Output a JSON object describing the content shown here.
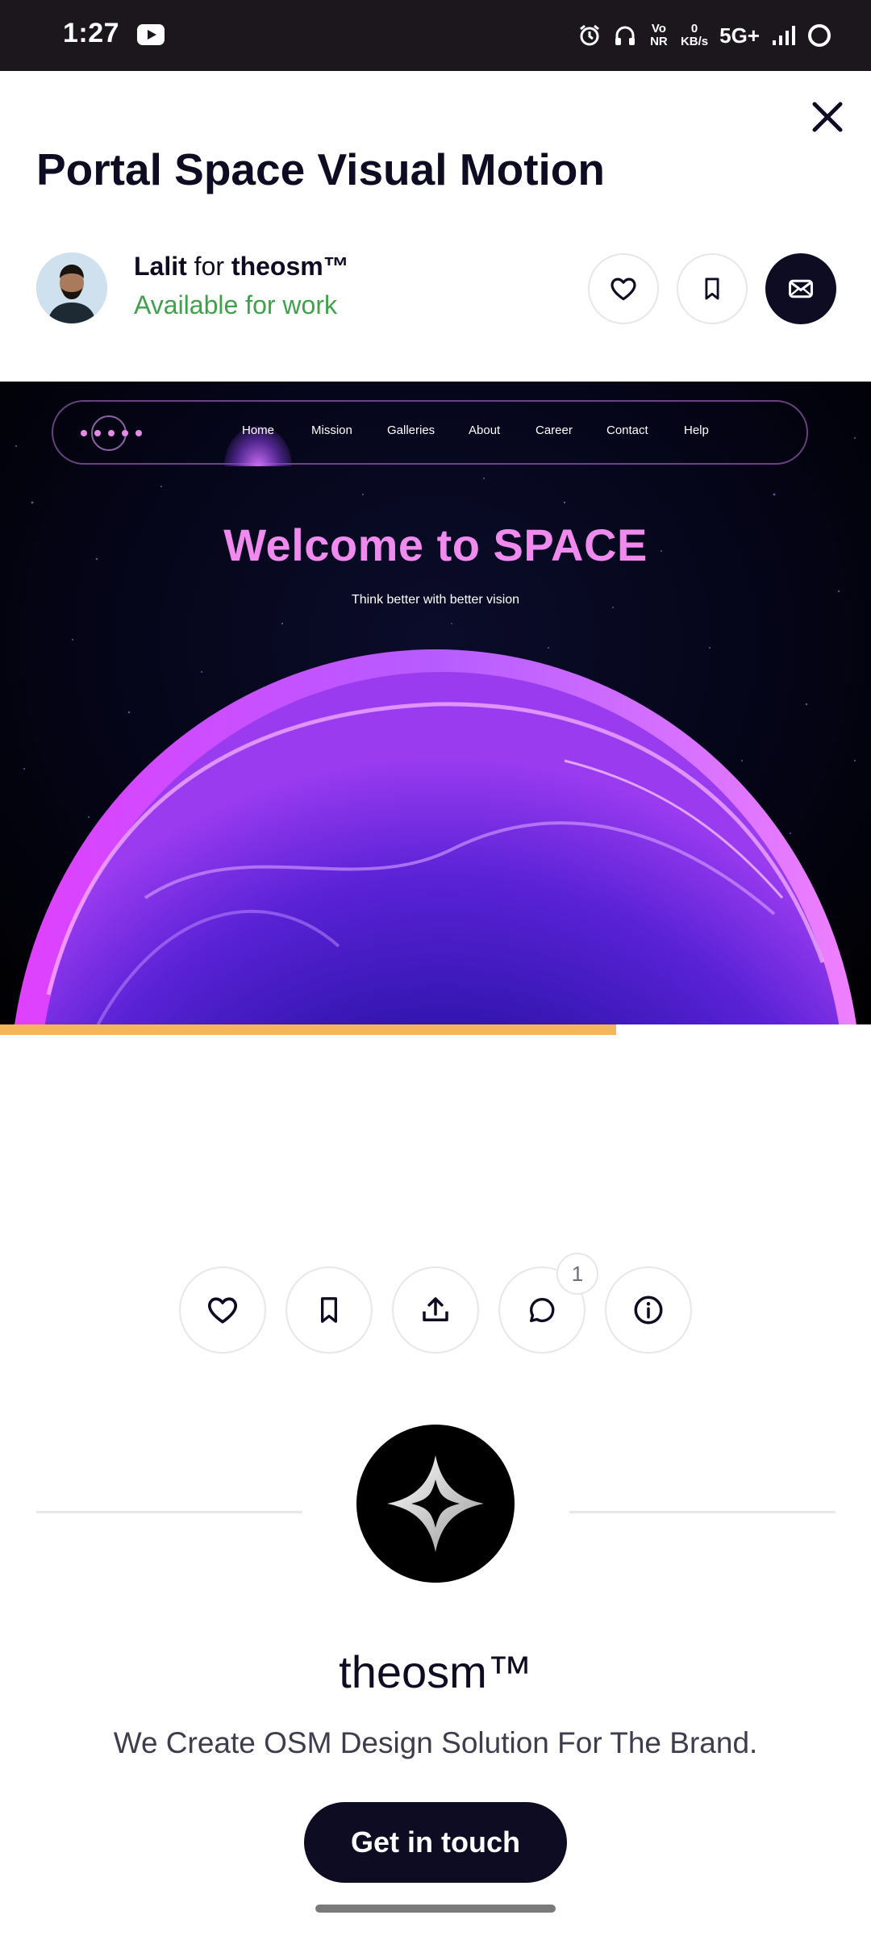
{
  "status_bar": {
    "time": "1:27",
    "indicators": [
      "alarm-icon",
      "headphones-icon"
    ],
    "volte": "Vo NR",
    "speed_value": "0",
    "speed_unit": "KB/s",
    "network": "5G+"
  },
  "shot": {
    "title": "Portal Space Visual Motion",
    "author": {
      "name": "Lalit",
      "for_word": "for",
      "team": "theosm™",
      "status": "Available for work"
    }
  },
  "preview": {
    "nav": [
      "Home",
      "Mission",
      "Galleries",
      "About",
      "Career",
      "Contact",
      "Help"
    ],
    "headline": "Welcome to SPACE",
    "tagline": "Think better with better vision",
    "progress_fraction": 0.707
  },
  "actions": {
    "comment_count": "1"
  },
  "team": {
    "name": "theosm™",
    "description": "We Create OSM Design Solution For The Brand.",
    "cta_label": "Get in touch"
  },
  "colors": {
    "primary_dark": "#0d0c22",
    "available_green": "#3fa14a",
    "progress_orange": "#f5b55a",
    "headline_pink": "#f08aee"
  }
}
